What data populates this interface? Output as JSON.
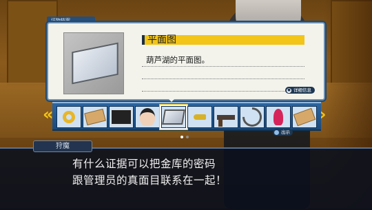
{
  "card": {
    "tab_label": "证物档案",
    "title": "平面图",
    "description": "葫芦湖的平面图。",
    "detail_button": "详细信息"
  },
  "evidence_strip": {
    "items": [
      {
        "name": "ring-icon"
      },
      {
        "name": "envelope-icon"
      },
      {
        "name": "photo-icon"
      },
      {
        "name": "portrait-icon"
      },
      {
        "name": "floor-plan-icon",
        "selected": true
      },
      {
        "name": "bullet-icon"
      },
      {
        "name": "pistol-icon"
      },
      {
        "name": "cable-icon"
      },
      {
        "name": "parrot-icon"
      },
      {
        "name": "envelope-icon"
      }
    ],
    "prev_arrow": "«",
    "next_arrow": "»",
    "page_count": 2,
    "current_page": 1,
    "present_button": "出示"
  },
  "dialogue": {
    "speaker": "狩魔",
    "line1": "有什么证据可以把金库的密码",
    "line2": "跟管理员的真面目联系在一起！"
  },
  "colors": {
    "accent_yellow": "#f2c518",
    "panel_blue": "#274f7a",
    "dialog_bg": "#0a101e"
  }
}
